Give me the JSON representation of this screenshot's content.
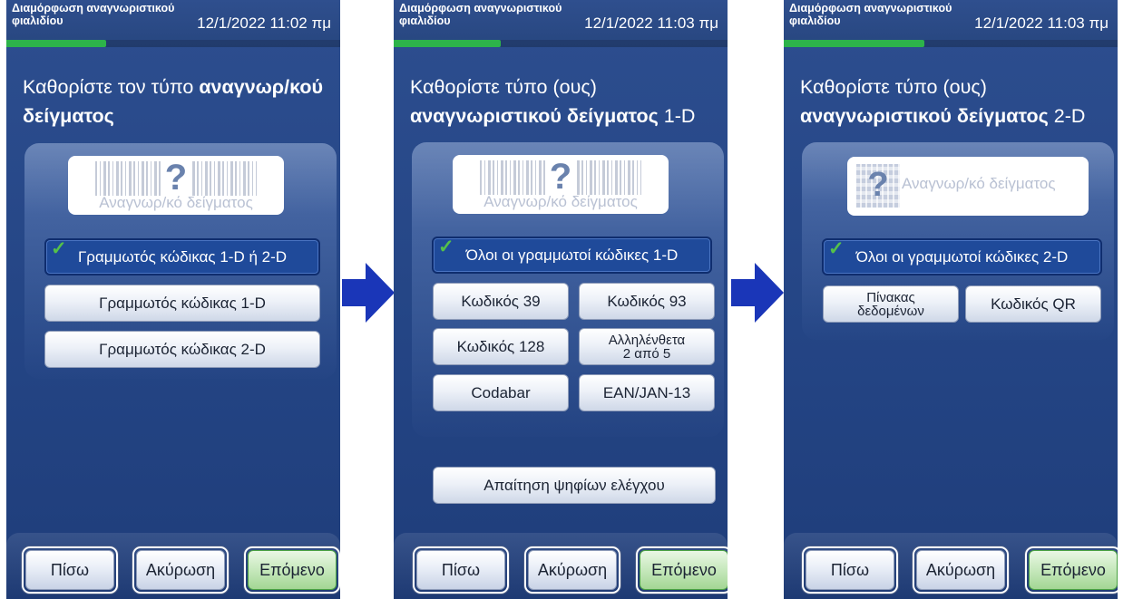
{
  "screens": [
    {
      "title": "Διαμόρφωση αναγνωριστικού φιαλιδίου",
      "time": "12/1/2022 11:02 πμ",
      "progress_fraction": 0.3,
      "heading_plain": "Καθορίστε τον τύπο ",
      "heading_bold": "αναγνωρ/κού δείγματος",
      "heading_suffix": "",
      "preview_label": "Αναγνωρ/κό δείγματος",
      "options": [
        {
          "label": "Γραμμωτός κώδικας 1-D ή 2-D",
          "selected": true
        },
        {
          "label": "Γραμμωτός κώδικας 1-D",
          "selected": false
        },
        {
          "label": "Γραμμωτός κώδικας 2-D",
          "selected": false
        }
      ],
      "footer": {
        "back": "Πίσω",
        "cancel": "Ακύρωση",
        "next": "Επόμενο"
      }
    },
    {
      "title": "Διαμόρφωση αναγνωριστικού φιαλιδίου",
      "time": "12/1/2022 11:03 πμ",
      "progress_fraction": 0.32,
      "heading_plain": "Καθορίστε τύπο (ους)",
      "heading_bold": "αναγνωριστικού δείγματος",
      "heading_suffix": " 1-D",
      "preview_label": "Αναγνωρ/κό δείγματος",
      "all_option": {
        "label": "Όλοι οι γραμμωτοί κώδικες 1-D",
        "selected": true
      },
      "codes": [
        "Κωδικός 39",
        "Κωδικός 93",
        "Κωδικός 128",
        "Αλληλένθετα 2 από 5",
        "Codabar",
        "EAN/JAN-13"
      ],
      "checkdigit": "Απαίτηση ψηφίων ελέγχου",
      "footer": {
        "back": "Πίσω",
        "cancel": "Ακύρωση",
        "next": "Επόμενο"
      }
    },
    {
      "title": "Διαμόρφωση αναγνωριστικού φιαλιδίου",
      "time": "12/1/2022 11:03 πμ",
      "progress_fraction": 0.42,
      "heading_plain": "Καθορίστε τύπο (ους)",
      "heading_bold": "αναγνωριστικού δείγματος",
      "heading_suffix": " 2-D",
      "preview_label": "Αναγνωρ/κό δείγματος",
      "all_option": {
        "label": "Όλοι οι γραμμωτοί κώδικες 2-D",
        "selected": true
      },
      "codes": [
        "Πίνακας δεδομένων",
        "Κωδικός QR"
      ],
      "footer": {
        "back": "Πίσω",
        "cancel": "Ακύρωση",
        "next": "Επόμενο"
      }
    }
  ],
  "colors": {
    "screen_bg": "#27478a",
    "progress": "#2db34a",
    "selected_button": "#1f4a9a",
    "next_button": "#a3d694",
    "arrow": "#1a36b8",
    "check": "#55c14a"
  },
  "icons": {
    "check": "check-icon",
    "barcode": "barcode-icon",
    "datamatrix": "datamatrix-icon",
    "arrow": "arrow-right-icon"
  }
}
